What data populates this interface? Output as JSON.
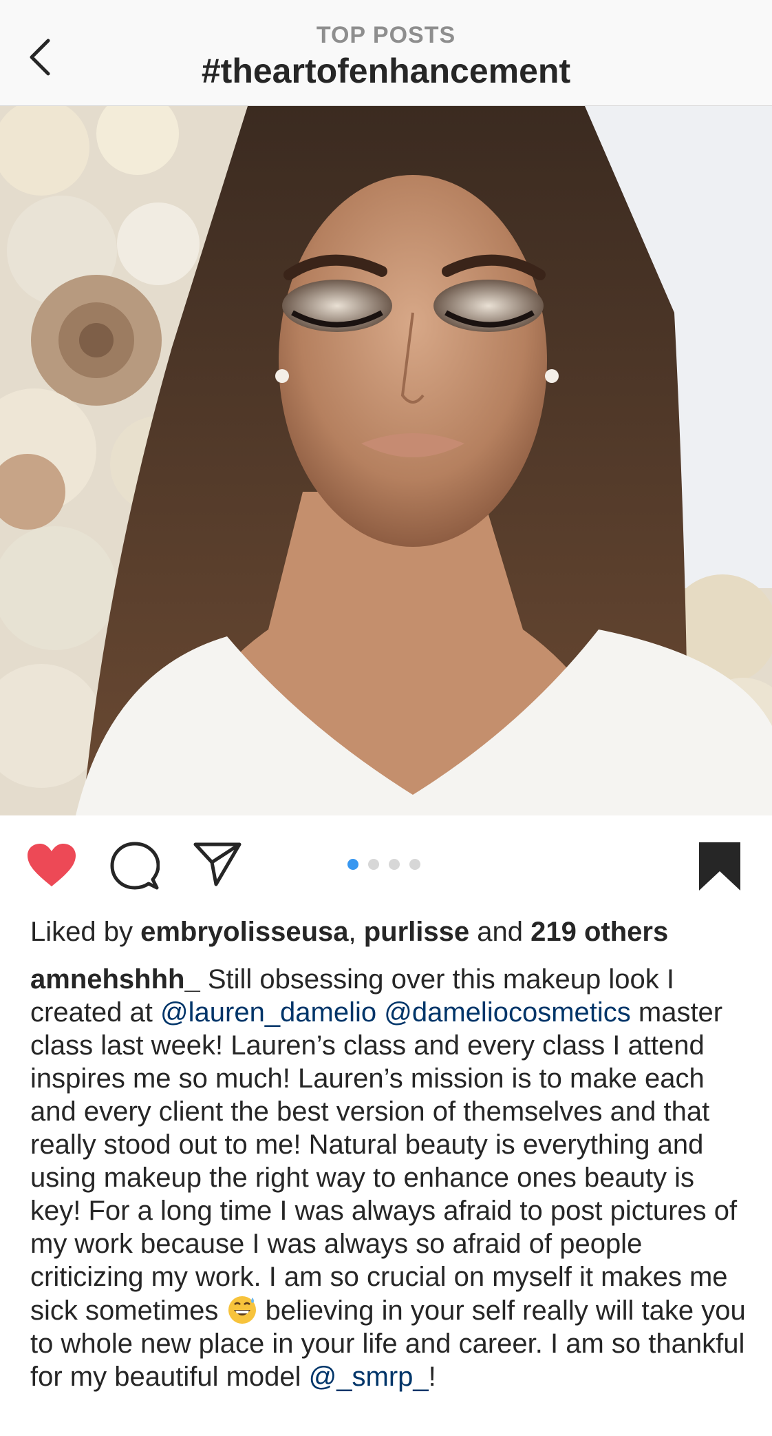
{
  "header": {
    "subtitle": "TOP POSTS",
    "title": "#theartofenhancement",
    "back_icon": "chevron-left-icon"
  },
  "post": {
    "photo_alt": "woman with eyes closed wearing shimmery eye makeup",
    "actions": {
      "like_icon": "heart-filled-icon",
      "comment_icon": "comment-icon",
      "share_icon": "direct-share-icon",
      "save_icon": "bookmark-filled-icon",
      "like_color": "#ed4956"
    },
    "carousel": {
      "count": 4,
      "active_index": 0,
      "active_color": "#3897f0"
    },
    "likes": {
      "prefix": "Liked by ",
      "user1": "embryolisseusa",
      "sep": ", ",
      "user2": "purlisse",
      "and": " and ",
      "others": "219 others"
    },
    "caption": {
      "username": "amnehshhh_",
      "text1": " Still obsessing over this makeup look I created at ",
      "mention1": "@lauren_damelio",
      "space": " ",
      "mention2": "@dameliocosmetics",
      "text2": " master class last week! Lauren’s class and every class I attend inspires me so much! Lauren’s mission is to make each and every client the best version of themselves and that really stood out to me! Natural beauty is everything and using makeup the right way to enhance ones beauty is key! For a long time I was always afraid to post pictures of my work because I was always so afraid of people criticizing  my work. I am so crucial on myself it makes me sick sometimes ",
      "emoji": "grinning-sweat-emoji",
      "text3": " believing in your self really will take you to whole new place in your life and career. I am so thankful for my beautiful model ",
      "mention3": "@_smrp_",
      "text4": "!",
      "mention_color": "#003569"
    }
  }
}
